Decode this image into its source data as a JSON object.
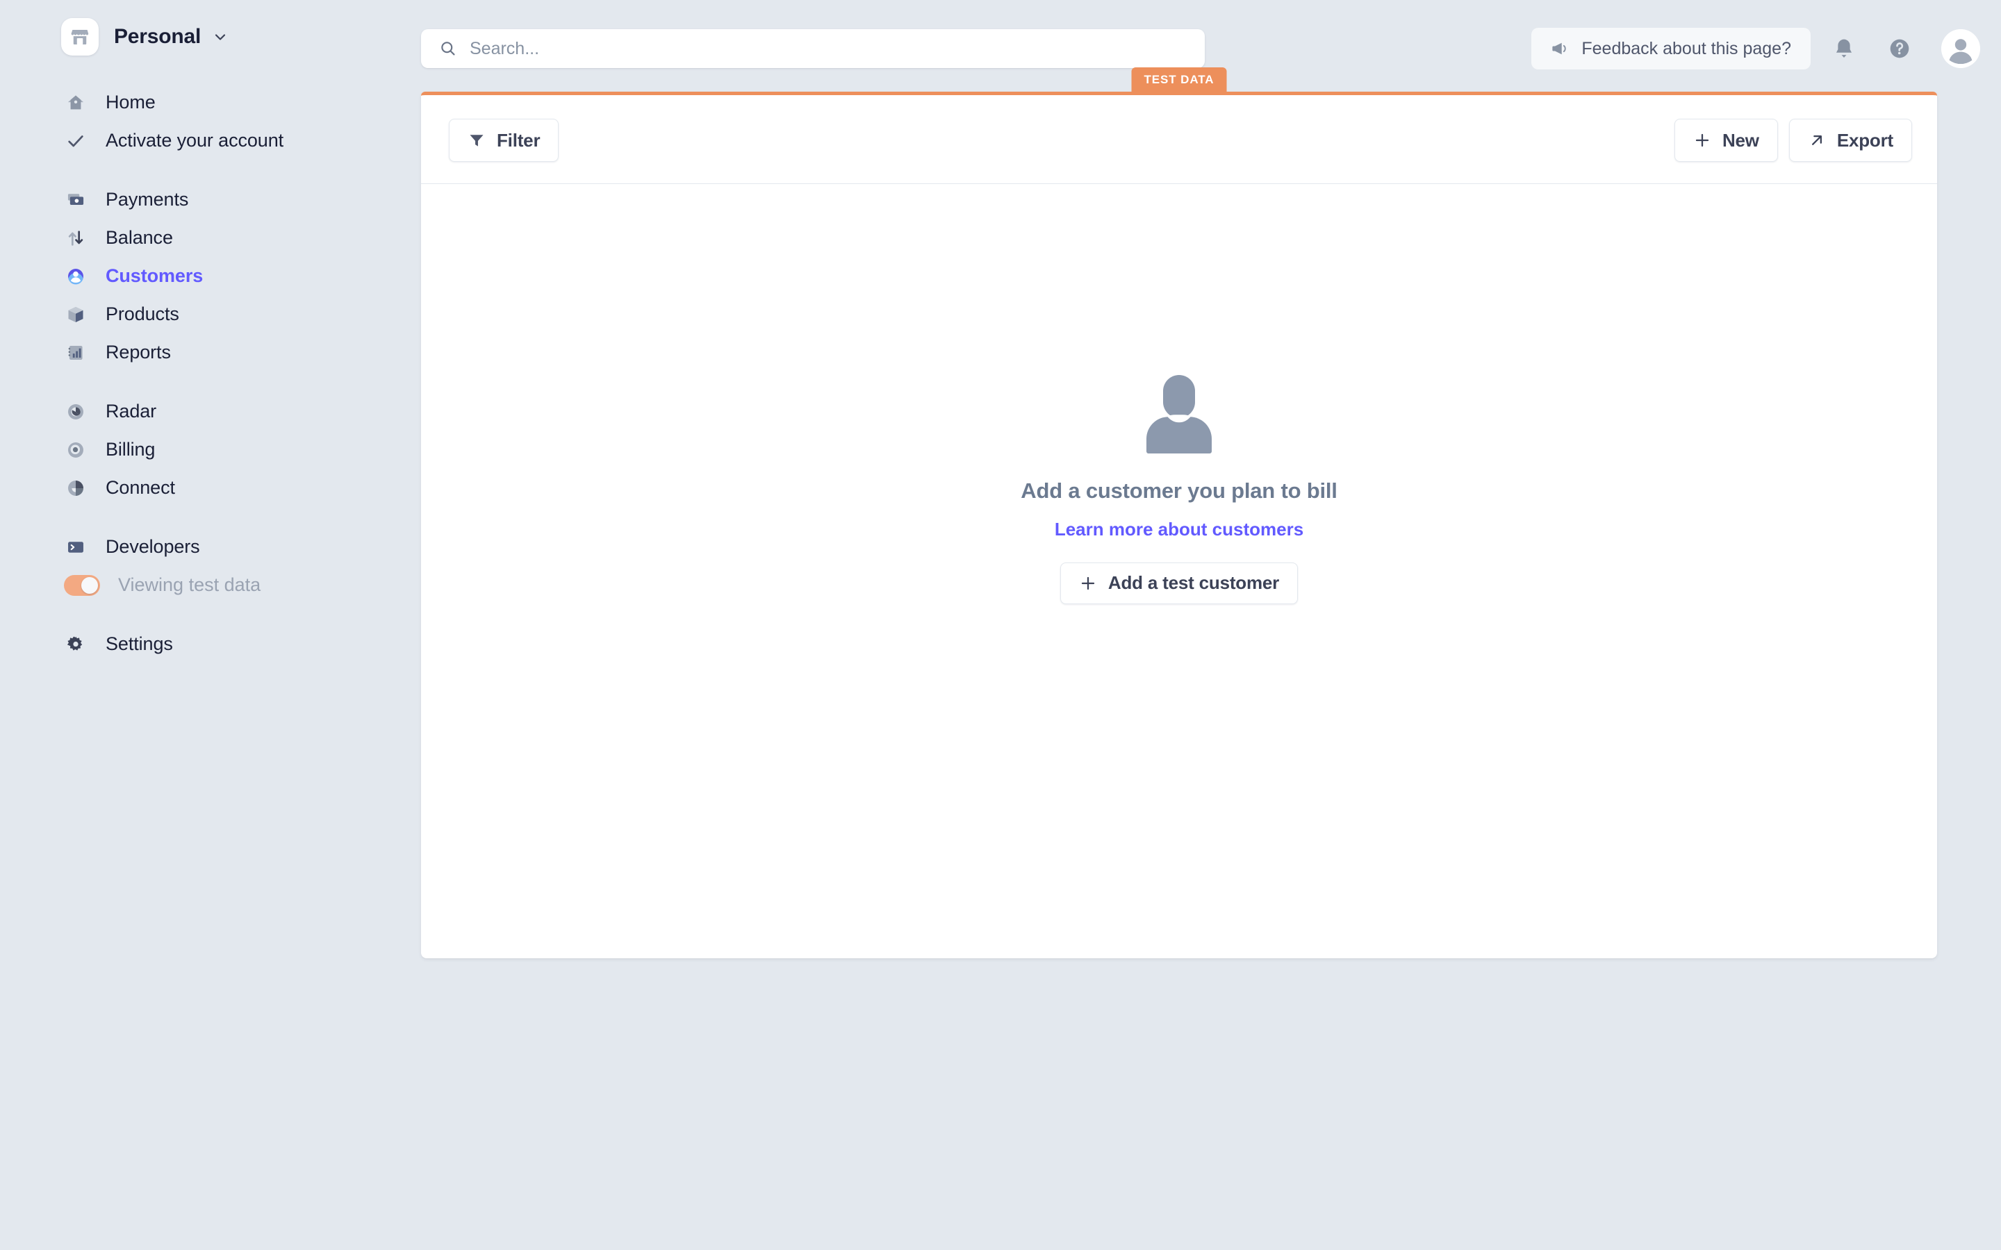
{
  "account": {
    "name": "Personal",
    "avatar_icon": "store-icon",
    "chevron_icon": "chevron-down-icon"
  },
  "sidebar": {
    "groups": [
      {
        "items": [
          {
            "label": "Home",
            "icon": "home-icon",
            "active": false
          },
          {
            "label": "Activate your account",
            "icon": "check-icon",
            "active": false
          }
        ]
      },
      {
        "items": [
          {
            "label": "Payments",
            "icon": "card-icon",
            "active": false
          },
          {
            "label": "Balance",
            "icon": "arrows-updown-icon",
            "active": false
          },
          {
            "label": "Customers",
            "icon": "person-circle-icon",
            "active": true
          },
          {
            "label": "Products",
            "icon": "box-icon",
            "active": false
          },
          {
            "label": "Reports",
            "icon": "bar-chart-icon",
            "active": false
          }
        ]
      },
      {
        "items": [
          {
            "label": "Radar",
            "icon": "radar-icon",
            "active": false
          },
          {
            "label": "Billing",
            "icon": "billing-circle-icon",
            "active": false
          },
          {
            "label": "Connect",
            "icon": "connect-icon",
            "active": false
          }
        ]
      },
      {
        "items": [
          {
            "label": "Developers",
            "icon": "terminal-icon",
            "active": false
          }
        ]
      },
      {
        "items": [
          {
            "label": "Settings",
            "icon": "gear-icon",
            "active": false
          }
        ]
      }
    ],
    "test_toggle": {
      "label": "Viewing test data",
      "enabled": true,
      "track_color": "#f3a982"
    },
    "active_color": "#625aff"
  },
  "topbar": {
    "search": {
      "placeholder": "Search...",
      "value": "",
      "icon": "search-icon"
    },
    "feedback": {
      "label": "Feedback about this page?",
      "icon": "megaphone-icon"
    },
    "notifications_icon": "bell-icon",
    "help_icon": "question-circle-icon",
    "avatar_icon": "user-avatar-icon"
  },
  "panel": {
    "test_badge": "TEST DATA",
    "accent_color": "#ed8f5b",
    "toolbar": {
      "filter_label": "Filter",
      "filter_icon": "funnel-icon",
      "new_label": "New",
      "new_icon": "plus-icon",
      "export_label": "Export",
      "export_icon": "arrow-up-right-icon"
    },
    "empty_state": {
      "illustration_icon": "person-silhouette-icon",
      "title": "Add a customer you plan to bill",
      "link_label": "Learn more about customers",
      "button_label": "Add a test customer",
      "button_icon": "plus-icon"
    }
  }
}
